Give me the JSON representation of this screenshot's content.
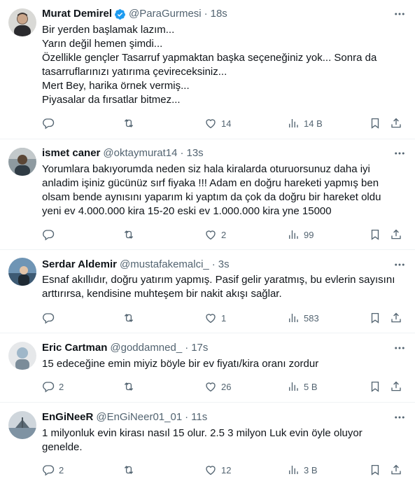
{
  "colors": {
    "text_primary": "#0f1419",
    "text_secondary": "#536471",
    "verified_badge": "#1d9bf0",
    "divider": "#eff3f4"
  },
  "icons": {
    "reply": "reply-icon",
    "retweet": "retweet-icon",
    "like": "heart-icon",
    "views": "analytics-icon",
    "bookmark": "bookmark-icon",
    "share": "share-icon",
    "more": "more-icon",
    "verified": "verified-badge-icon"
  },
  "tweets": [
    {
      "name": "Murat Demirel",
      "verified": true,
      "handle": "@ParaGurmesi",
      "time": "18s",
      "lines": [
        "Bir yerden başlamak lazım...",
        "Yarın değil hemen şimdi...",
        "Özellikle gençler Tasarruf yapmaktan başka seçeneğiniz yok... Sonra da",
        "tasarruflarınızı yatırıma çevireceksiniz...",
        "Mert Bey, harika örnek vermiş...",
        "Piyasalar da fırsatlar bitmez..."
      ],
      "replies": "",
      "retweets": "",
      "likes": "14",
      "views": "14 B"
    },
    {
      "name": "ismet caner",
      "verified": false,
      "handle": "@oktaymurat14",
      "time": "13s",
      "lines": [
        "Yorumlara bakıyorumda neden siz hala kiralarda oturuorsunuz daha iyi",
        "anladim işiniz gücünüz sırf fiyaka !!! Adam en doğru hareketi yapmış ben",
        "olsam bende aynısını yaparım ki yaptım da çok da doğru bir hareket oldu",
        "yeni ev 4.000.000 kira 15-20 eski ev 1.000.000 kira yne 15000"
      ],
      "replies": "",
      "retweets": "",
      "likes": "2",
      "views": "99"
    },
    {
      "name": "Serdar Aldemir",
      "verified": false,
      "handle": "@mustafakemalci_",
      "time": "3s",
      "lines": [
        "Esnaf akıllıdır, doğru yatırım yapmış. Pasif gelir yaratmış, bu evlerin sayısını",
        "arttırırsa, kendisine muhteşem bir nakit akışı sağlar."
      ],
      "replies": "",
      "retweets": "",
      "likes": "1",
      "views": "583"
    },
    {
      "name": "Eric Cartman",
      "verified": false,
      "handle": "@goddamned_",
      "time": "17s",
      "lines": [
        "15 edeceğine emin miyiz böyle bir ev fiyatı/kira oranı zordur"
      ],
      "replies": "2",
      "retweets": "",
      "likes": "26",
      "views": "5 B"
    },
    {
      "name": "EnGiNeeR",
      "verified": false,
      "handle": "@EnGiNeer01_01",
      "time": "11s",
      "lines": [
        "1 milyonluk evin kirası nasıl 15 olur. 2.5 3 milyon Luk evin öyle oluyor",
        "genelde."
      ],
      "replies": "2",
      "retweets": "",
      "likes": "12",
      "views": "3 B"
    }
  ]
}
